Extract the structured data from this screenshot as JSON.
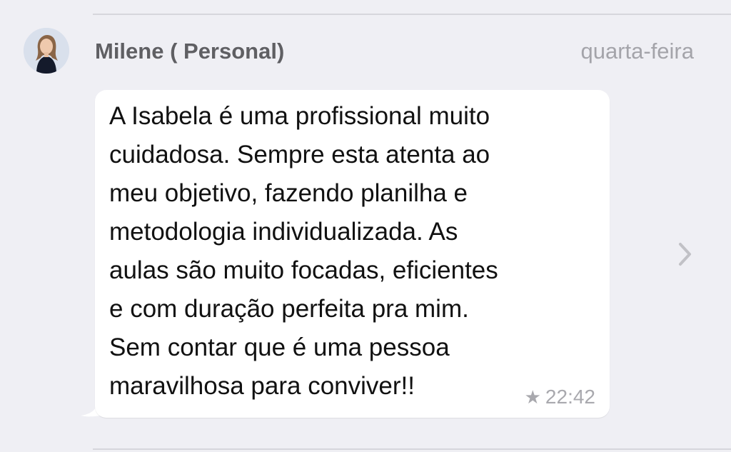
{
  "message": {
    "sender": "Milene ( Personal)",
    "date": "quarta-feira",
    "text": "A Isabela é uma profissional muito\ncuidadosa. Sempre esta atenta ao\nmeu objetivo, fazendo planilha e\nmetodologia individualizada. As\naulas são muito focadas, eficientes\ne com duração perfeita pra mim.\nSem contar que é uma pessoa\nmaravilhosa para conviver!!",
    "time": "22:42",
    "starred": true
  },
  "icons": {
    "star": "★",
    "star_name": "star-icon",
    "chevron_name": "chevron-right-icon"
  },
  "colors": {
    "background": "#efeff4",
    "bubble": "#ffffff",
    "sender": "#5f5f63",
    "muted": "#a4a4aa"
  }
}
